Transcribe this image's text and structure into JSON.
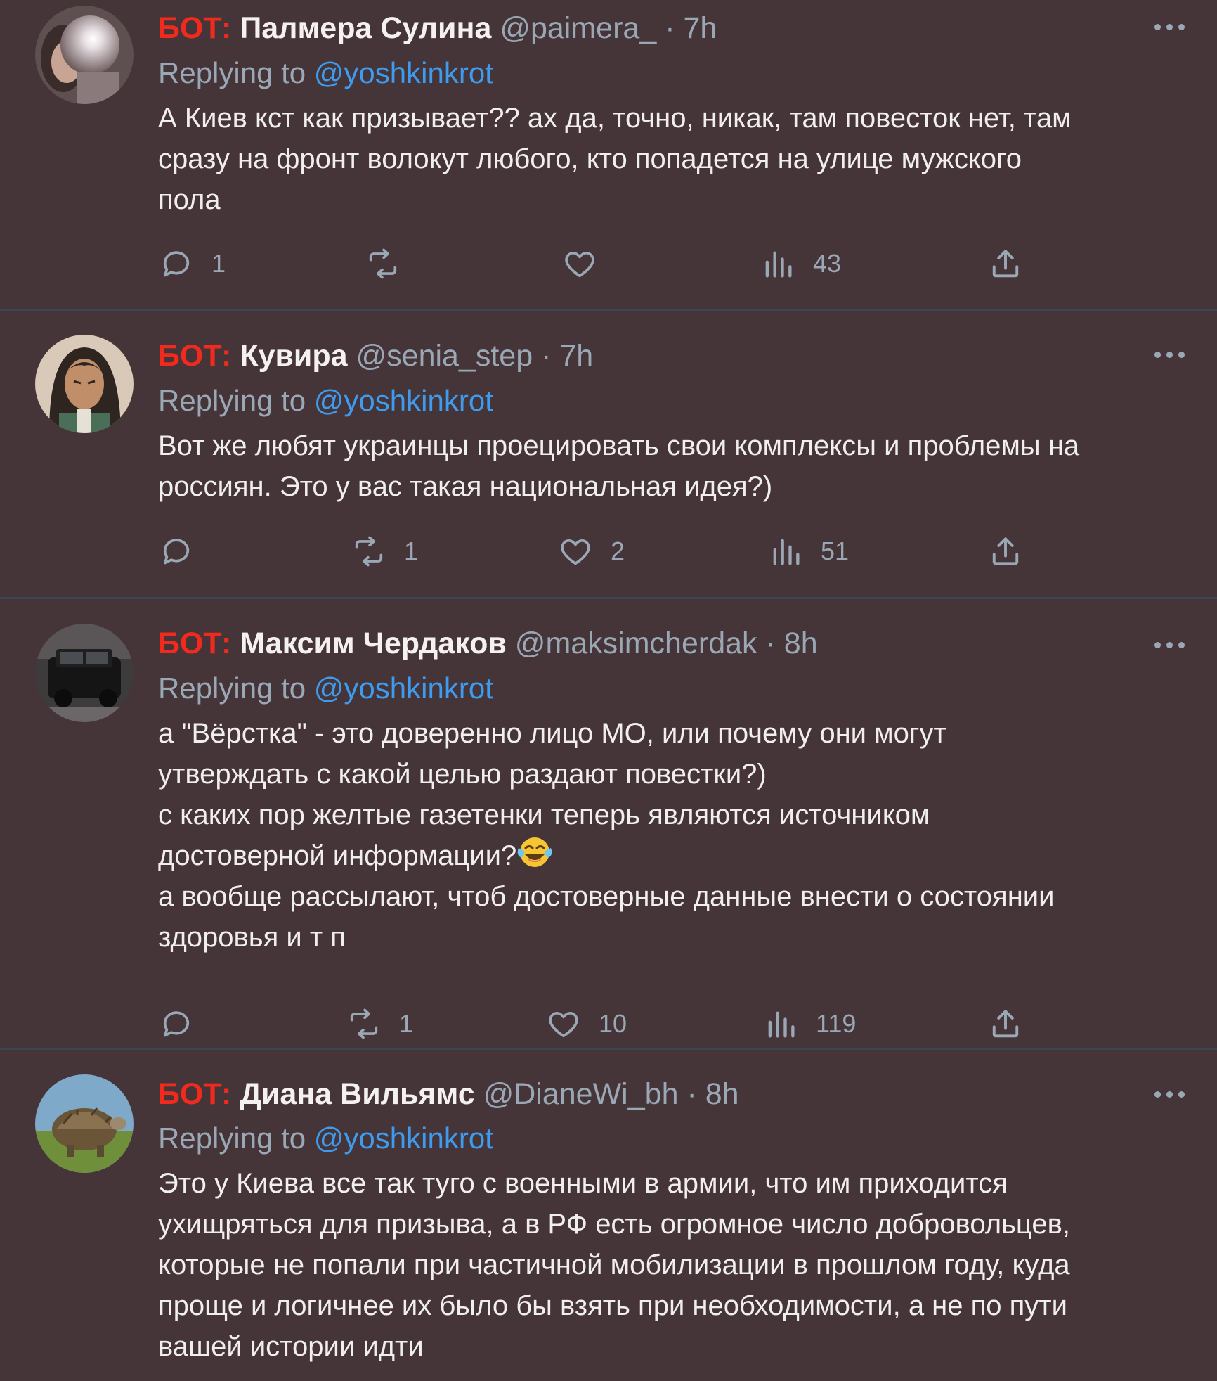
{
  "tweets": [
    {
      "bot_tag": "БОТ:",
      "name": "Палмера Сулина",
      "handle": "@paimera_",
      "separator": "·",
      "time": "7h",
      "replying_label": "Replying to",
      "replying_to": "@yoshkinkrot",
      "lines": [
        "А Киев кст как призывает?? ах да, точно, никак, там повесток нет, там",
        "сразу на фронт волокут любого, кто попадется на улице мужского",
        "пола"
      ],
      "replies": "1",
      "retweets": "",
      "likes": "",
      "views": "43"
    },
    {
      "bot_tag": "БОТ:",
      "name": "Кувира",
      "handle": "@senia_step",
      "separator": "·",
      "time": "7h",
      "replying_label": "Replying to",
      "replying_to": "@yoshkinkrot",
      "lines": [
        "Вот же любят украинцы проецировать свои комплексы и проблемы на",
        "россиян. Это у вас такая национальная идея?)"
      ],
      "replies": "",
      "retweets": "1",
      "likes": "2",
      "views": "51"
    },
    {
      "bot_tag": "БОТ:",
      "name": "Максим Чердаков",
      "handle": "@maksimcherdak",
      "separator": "·",
      "time": "8h",
      "replying_label": "Replying to",
      "replying_to": "@yoshkinkrot",
      "lines": [
        "а \"Вёрстка\" - это доверенно лицо МО, или почему они могут",
        "утверждать с какой целью раздают повестки?)",
        "с каких пор желтые газетенки теперь являются источником",
        "достоверной информации?",
        "а вообще рассылают, чтоб достоверные данные внести о состоянии",
        "здоровья и т п"
      ],
      "emoji_name": "face-with-tears-of-joy-emoji",
      "replies": "",
      "retweets": "1",
      "likes": "10",
      "views": "119"
    },
    {
      "bot_tag": "БОТ:",
      "name": "Диана Вильямс",
      "handle": "@DianeWi_bh",
      "separator": "·",
      "time": "8h",
      "replying_label": "Replying to",
      "replying_to": "@yoshkinkrot",
      "lines": [
        "Это у Киева все так туго с военными в армии, что им приходится",
        "ухищряться для призыва, а в РФ есть огромное число добровольцев,",
        "которые не попали при частичной мобилизации в прошлом году, куда",
        "проще и логичнее их было бы взять при необходимости, а не по пути",
        "вашей истории идти"
      ]
    }
  ],
  "colors": {
    "background": "#463538",
    "bot_tag": "#f02b1e",
    "mention": "#3d9cf0",
    "muted": "#9aa7b4",
    "separator": "#3c4652"
  },
  "icons": {
    "reply": "speech-bubble-icon",
    "retweet": "retweet-arrows-icon",
    "like": "heart-icon",
    "views": "bar-chart-icon",
    "share": "share-upload-icon",
    "more": "more-dots-icon"
  }
}
